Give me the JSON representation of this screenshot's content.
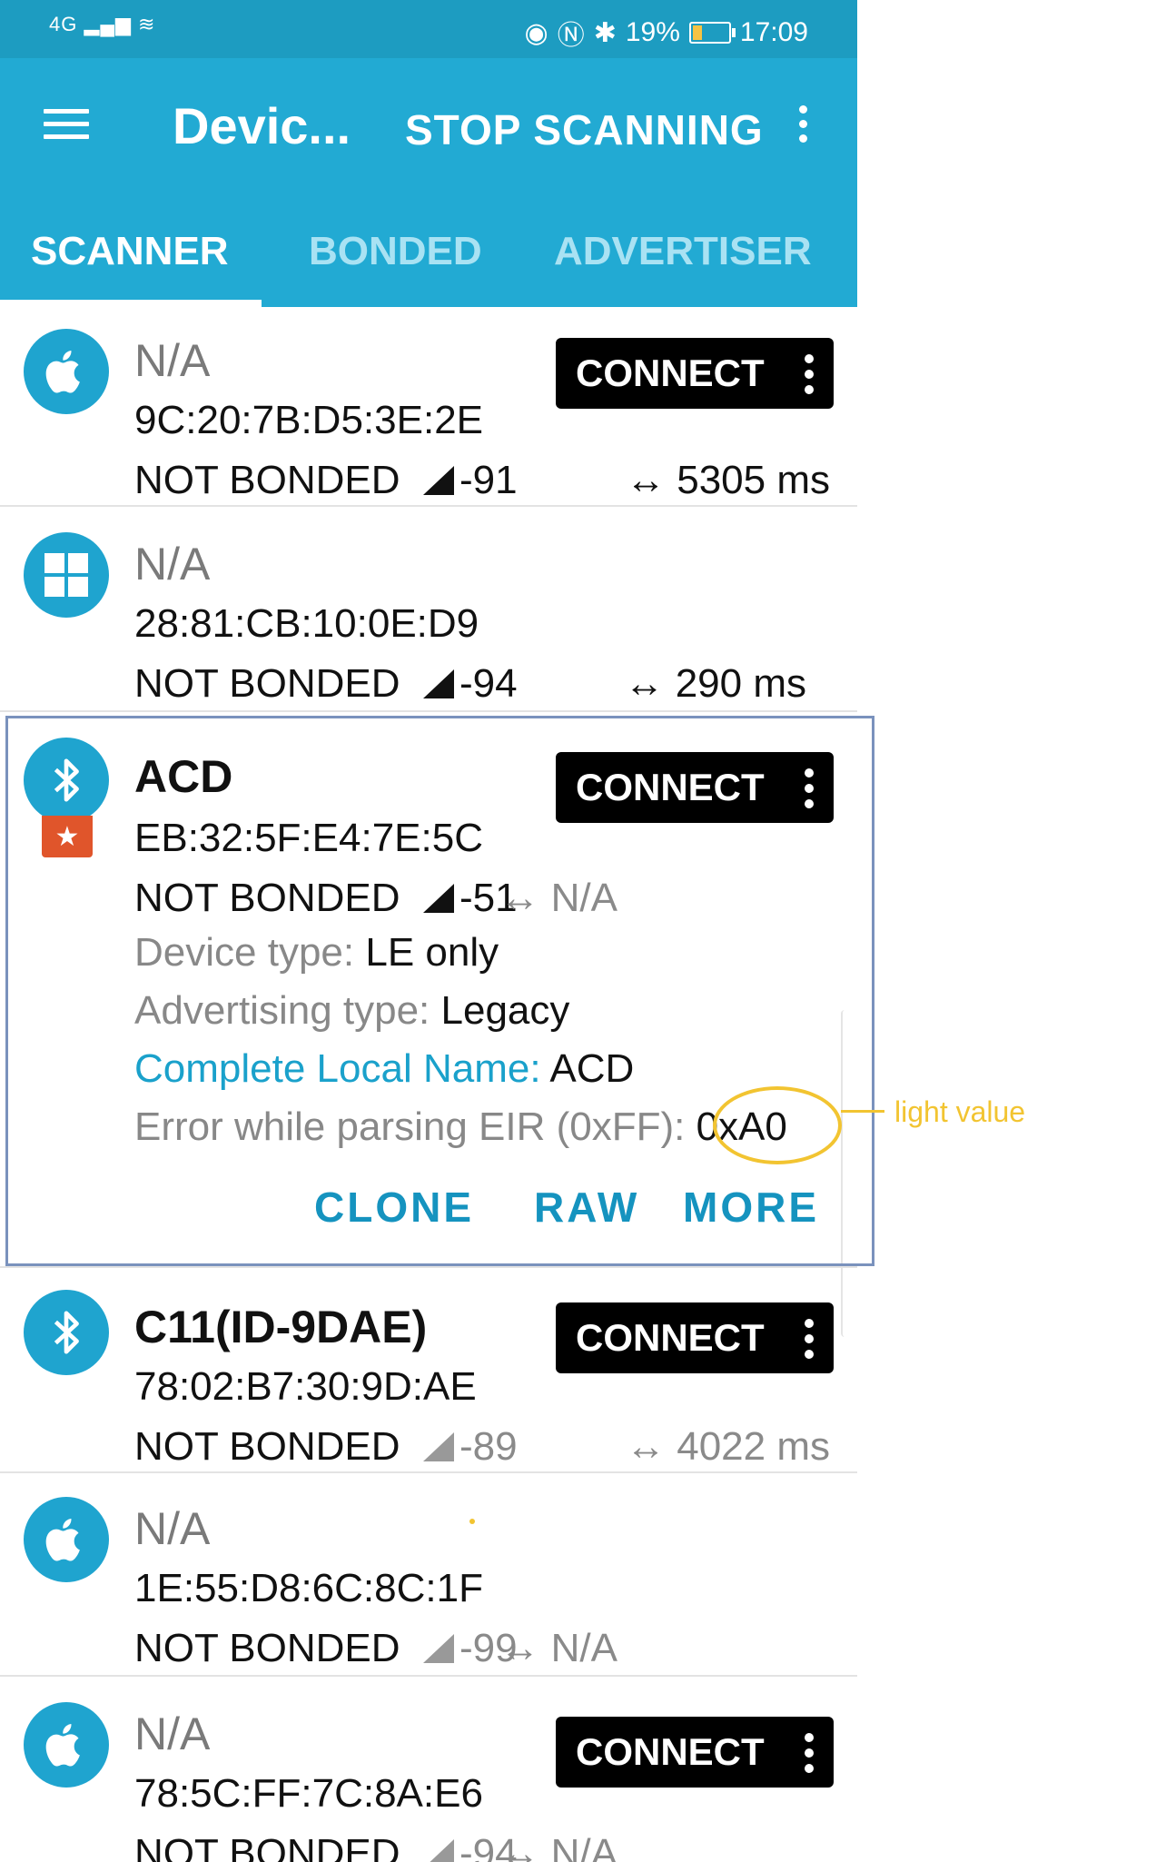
{
  "status_bar": {
    "network": "4G",
    "battery": "19%",
    "time": "17:09"
  },
  "toolbar": {
    "title": "Devic...",
    "action": "STOP SCANNING"
  },
  "tabs": [
    {
      "label": "SCANNER"
    },
    {
      "label": "BONDED"
    },
    {
      "label": "ADVERTISER"
    }
  ],
  "devices": [
    {
      "name": "N/A",
      "mac": "9C:20:7B:D5:3E:2E",
      "bond": "NOT BONDED",
      "rssi": "-91",
      "interval": "5305 ms",
      "connect": "CONNECT",
      "icon": "apple-icon"
    },
    {
      "name": "N/A",
      "mac": "28:81:CB:10:0E:D9",
      "bond": "NOT BONDED",
      "rssi": "-94",
      "interval": "290 ms",
      "icon": "windows-icon"
    },
    {
      "name": "ACD",
      "mac": "EB:32:5F:E4:7E:5C",
      "bond": "NOT BONDED",
      "rssi": "-51",
      "interval": "N/A",
      "connect": "CONNECT",
      "icon": "bluetooth-icon",
      "details": {
        "device_type_label": "Device type: ",
        "device_type": "LE only",
        "adv_type_label": "Advertising type: ",
        "adv_type": "Legacy",
        "local_name_label": "Complete Local Name: ",
        "local_name": "ACD",
        "eir_label": "Error while parsing EIR (0xFF): ",
        "eir_value": "0xA0"
      },
      "actions": {
        "clone": "CLONE",
        "raw": "RAW",
        "more": "MORE"
      }
    },
    {
      "name": "C11(ID-9DAE)",
      "mac": "78:02:B7:30:9D:AE",
      "bond": "NOT BONDED",
      "rssi": "-89",
      "interval": "4022 ms",
      "connect": "CONNECT",
      "icon": "bluetooth-icon"
    },
    {
      "name": "N/A",
      "mac": "1E:55:D8:6C:8C:1F",
      "bond": "NOT BONDED",
      "rssi": "-99",
      "interval": "N/A",
      "icon": "apple-icon"
    },
    {
      "name": "N/A",
      "mac": "78:5C:FF:7C:8A:E6",
      "bond": "NOT BONDED",
      "rssi": "-94",
      "interval": "N/A",
      "connect": "CONNECT",
      "icon": "apple-icon"
    }
  ],
  "annotation": {
    "label": "light value"
  },
  "colors": {
    "primary": "#22aad3",
    "status_bar": "#1d9cc1",
    "link": "#1aa1cb",
    "annotation": "#f2c431",
    "favorite_badge": "#e0552b"
  }
}
